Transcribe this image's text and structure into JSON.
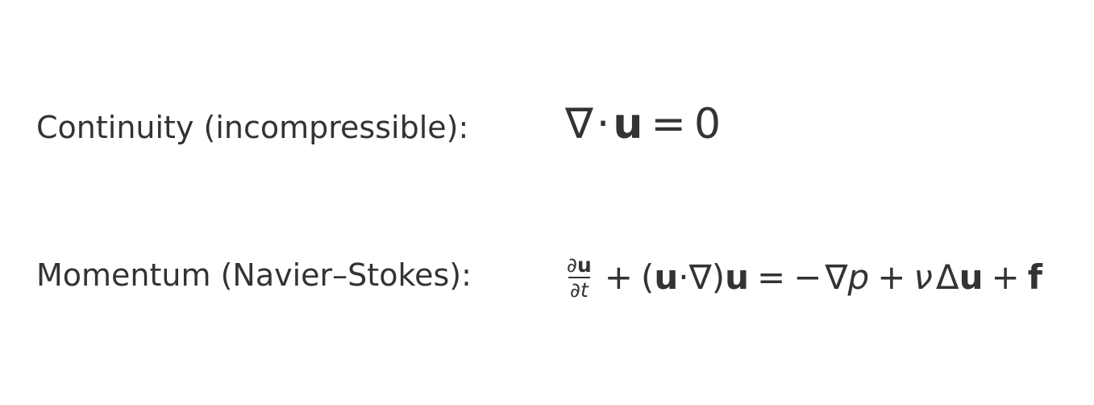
{
  "equations": [
    {
      "label": "Continuity (incompressible):",
      "formula": {
        "nabla": "∇",
        "dot": "·",
        "u": "u",
        "equals": "=",
        "zero": "0"
      }
    },
    {
      "label": "Momentum (Navier–Stokes):",
      "formula": {
        "frac_num_partial": "∂",
        "frac_num_u": "u",
        "frac_den_partial": "∂",
        "frac_den_t": "t",
        "plus1": "+",
        "lparen": "(",
        "u1": "u",
        "dot": "·",
        "nabla1": "∇",
        "rparen": ")",
        "u2": "u",
        "equals": "=",
        "minus": "−",
        "nabla2": "∇",
        "p": "p",
        "plus2": "+",
        "nu": "ν",
        "laplacian": "Δ",
        "u3": "u",
        "plus3": "+",
        "f": "f"
      }
    }
  ]
}
